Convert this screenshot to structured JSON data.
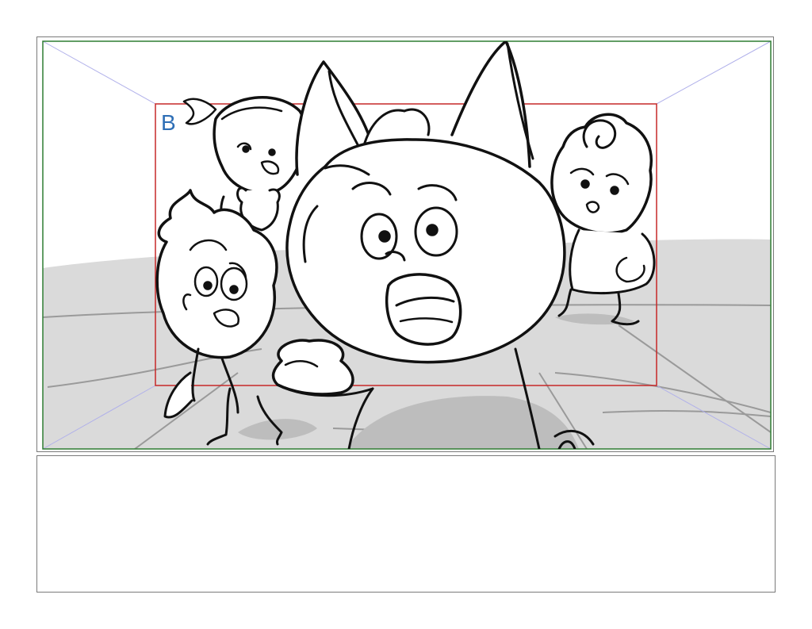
{
  "storyboard": {
    "camera_label": "B",
    "notes_text": "",
    "colors": {
      "outer_frame": "#7a7a7a",
      "safe_frame": "#2e7d32",
      "camera_frame": "#c62828",
      "perspective_lines": "#a8a8e8",
      "floor_shade": "#d9d9d9",
      "ink": "#111111",
      "label": "#2f6fb6"
    },
    "icons": [
      "cat-character-drawing",
      "girl-with-bow-drawing",
      "boy-with-messy-hair-drawing",
      "girl-with-curl-drawing"
    ]
  }
}
